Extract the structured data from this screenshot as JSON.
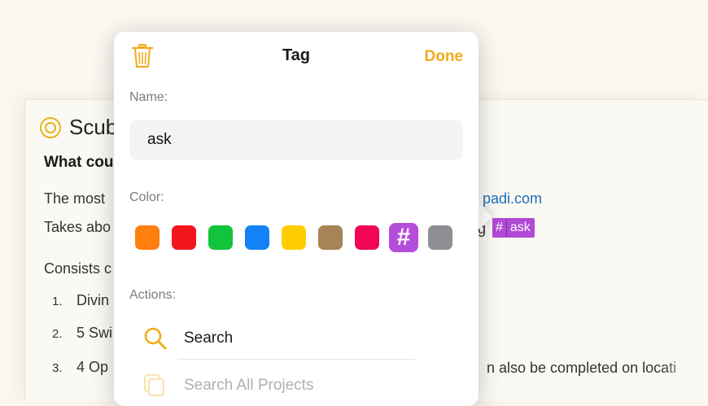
{
  "document": {
    "title": "Scub",
    "heading": "What cou",
    "line1": "The most",
    "line2": "Takes abo",
    "line3": "Consists c",
    "link_text": "padi.com",
    "frag_g": "g",
    "list": [
      {
        "num": "1.",
        "text": "Divin"
      },
      {
        "num": "2.",
        "text": "5 Swi"
      },
      {
        "num": "3.",
        "text": "4 Op"
      }
    ],
    "list_tail": "n also be completed on locati",
    "tag_pill": {
      "hash": "#",
      "text": "ask"
    }
  },
  "popover": {
    "title": "Tag",
    "done_label": "Done",
    "name_label": "Name:",
    "name_value": "ask",
    "color_label": "Color:",
    "selected_glyph": "#",
    "colors": [
      "#ff7f0f",
      "#f2161e",
      "#11c43b",
      "#1482f7",
      "#ffcc00",
      "#a88356",
      "#f10655",
      "#b44ddb",
      "#8e8e93"
    ],
    "actions_label": "Actions:",
    "actions": [
      {
        "label": "Search",
        "icon": "search-icon"
      },
      {
        "label": "Search All Projects",
        "icon": "search-all-projects-icon"
      }
    ],
    "accent_color": "#f0ab1a"
  }
}
